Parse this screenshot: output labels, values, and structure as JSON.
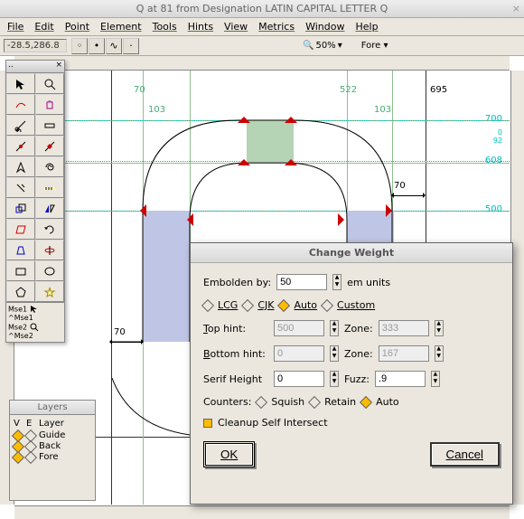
{
  "title": "Q at 81 from Designation LATIN CAPITAL LETTER Q",
  "menu": [
    "File",
    "Edit",
    "Point",
    "Element",
    "Tools",
    "Hints",
    "View",
    "Metrics",
    "Window",
    "Help"
  ],
  "coords": "-28.5,286.8",
  "zoom": "50%",
  "active_layer": "Fore",
  "canvas_labels": {
    "g70a": "70",
    "g70b": "70",
    "g522": "522",
    "g695": "695",
    "g103a": "103",
    "g103b": "103",
    "h700": "700",
    "h608": "608",
    "h500": "500",
    "h0s": "0",
    "h92": "92",
    "dim70a": "70",
    "dim70b": "70"
  },
  "palette_footer": {
    "l1": "Mse1",
    "l2": "^Mse1",
    "l3": "Mse2",
    "l4": "^Mse2"
  },
  "layers": {
    "title": "Layers",
    "hdr_v": "V",
    "hdr_e": "E",
    "hdr_l": "Layer",
    "rows": [
      {
        "name": "Guide",
        "v": true,
        "e": false
      },
      {
        "name": "Back",
        "v": true,
        "e": false
      },
      {
        "name": "Fore",
        "v": true,
        "e": false
      }
    ]
  },
  "dialog": {
    "title": "Change Weight",
    "embolden_label": "Embolden by:",
    "embolden_value": "50",
    "embolden_units": "em units",
    "scripts": {
      "lcg": "LCG",
      "cjk": "CJK",
      "auto": "Auto",
      "custom": "Custom",
      "selected": "auto"
    },
    "top_hint_label": "Top hint:",
    "top_hint": "500",
    "top_zone_label": "Zone:",
    "top_zone": "333",
    "bot_hint_label": "Bottom hint:",
    "bot_hint": "0",
    "bot_zone_label": "Zone:",
    "bot_zone": "167",
    "serif_label": "Serif Height",
    "serif": "0",
    "fuzz_label": "Fuzz:",
    "fuzz": ".9",
    "counters_label": "Counters:",
    "counters": {
      "squish": "Squish",
      "retain": "Retain",
      "auto": "Auto",
      "selected": "auto"
    },
    "cleanup": "Cleanup Self Intersect",
    "cleanup_on": true,
    "ok": "OK",
    "cancel": "Cancel"
  }
}
